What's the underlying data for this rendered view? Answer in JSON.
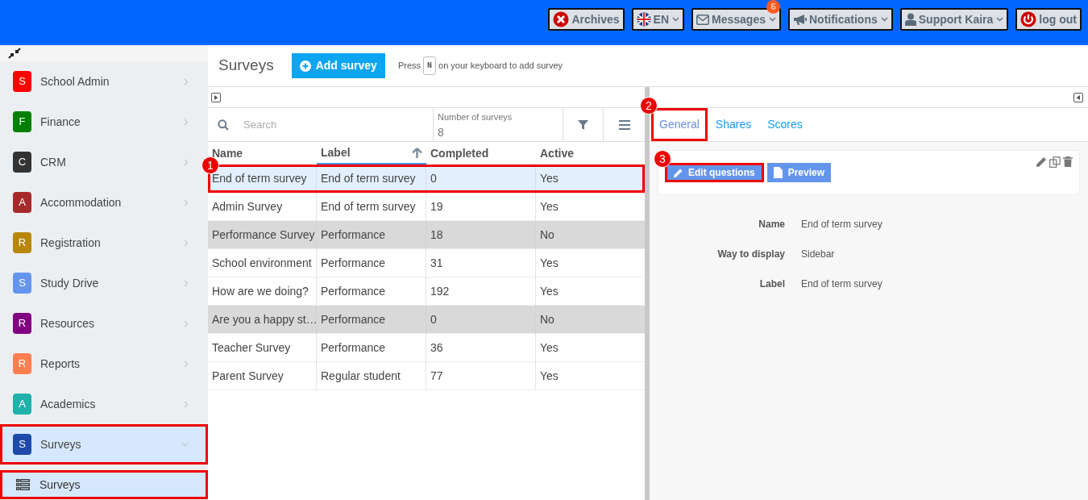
{
  "top_bar": {
    "buttons": [
      {
        "kind": "archives",
        "label": "Archives",
        "dropdown": false
      },
      {
        "kind": "language",
        "label": "EN",
        "dropdown": true
      },
      {
        "kind": "messages",
        "label": "Messages",
        "dropdown": true,
        "badge": "6"
      },
      {
        "kind": "notifications",
        "label": "Notifications",
        "dropdown": true
      },
      {
        "kind": "user",
        "label": "Support Kaira",
        "dropdown": true
      },
      {
        "kind": "logout",
        "label": "log out",
        "dropdown": false
      }
    ]
  },
  "sidebar": {
    "items": [
      {
        "letter": "S",
        "label": "School Admin",
        "color": "#ff0000",
        "selected": false,
        "expanded": false,
        "highlighted": false
      },
      {
        "letter": "F",
        "label": "Finance",
        "color": "#008000",
        "selected": false,
        "expanded": false,
        "highlighted": false
      },
      {
        "letter": "C",
        "label": "CRM",
        "color": "#333333",
        "selected": false,
        "expanded": false,
        "highlighted": false
      },
      {
        "letter": "A",
        "label": "Accommodation",
        "color": "#a52a2a",
        "selected": false,
        "expanded": false,
        "highlighted": false
      },
      {
        "letter": "R",
        "label": "Registration",
        "color": "#b8860b",
        "selected": false,
        "expanded": false,
        "highlighted": false
      },
      {
        "letter": "S",
        "label": "Study Drive",
        "color": "#6495ed",
        "selected": false,
        "expanded": false,
        "highlighted": false
      },
      {
        "letter": "R",
        "label": "Resources",
        "color": "#800080",
        "selected": false,
        "expanded": false,
        "highlighted": false
      },
      {
        "letter": "R",
        "label": "Reports",
        "color": "#ff7f50",
        "selected": false,
        "expanded": false,
        "highlighted": false
      },
      {
        "letter": "A",
        "label": "Academics",
        "color": "#20b2aa",
        "selected": false,
        "expanded": false,
        "highlighted": false
      },
      {
        "letter": "S",
        "label": "Surveys",
        "color": "#1e4bab",
        "selected": true,
        "expanded": true,
        "highlighted": true,
        "children": [
          {
            "label": "Surveys",
            "selected": true,
            "highlighted": true
          }
        ]
      }
    ]
  },
  "page_header": {
    "title": "Surveys",
    "add_button": "Add survey",
    "hint_before": "Press",
    "hint_key": "N",
    "hint_after": "on your keyboard to add survey"
  },
  "table": {
    "search": {
      "placeholder": "Search"
    },
    "count_label": "Number of surveys",
    "count": "8",
    "columns": [
      {
        "label": "Name",
        "sorted": false
      },
      {
        "label": "Label",
        "sorted": true
      },
      {
        "label": "Completed",
        "sorted": false
      },
      {
        "label": "Active",
        "sorted": false
      }
    ],
    "rows": [
      {
        "cells": [
          "End of term survey",
          "End of term survey",
          "0",
          "Yes"
        ],
        "selected": true,
        "greyed": false,
        "highlighted": true,
        "callout": "1"
      },
      {
        "cells": [
          "Admin Survey",
          "End of term survey",
          "19",
          "Yes"
        ],
        "selected": false,
        "greyed": false,
        "highlighted": false
      },
      {
        "cells": [
          "Performance Survey",
          "Performance",
          "18",
          "No"
        ],
        "selected": false,
        "greyed": true,
        "highlighted": false
      },
      {
        "cells": [
          "School environment",
          "Performance",
          "31",
          "Yes"
        ],
        "selected": false,
        "greyed": false,
        "highlighted": false
      },
      {
        "cells": [
          "How are we doing?",
          "Performance",
          "192",
          "Yes"
        ],
        "selected": false,
        "greyed": false,
        "highlighted": false
      },
      {
        "cells": [
          "Are you a happy st…",
          "Performance",
          "0",
          "No"
        ],
        "selected": false,
        "greyed": true,
        "highlighted": false
      },
      {
        "cells": [
          "Teacher Survey",
          "Performance",
          "36",
          "Yes"
        ],
        "selected": false,
        "greyed": false,
        "highlighted": false
      },
      {
        "cells": [
          "Parent Survey",
          "Regular student",
          "77",
          "Yes"
        ],
        "selected": false,
        "greyed": false,
        "highlighted": false
      }
    ]
  },
  "detail": {
    "tabs": [
      {
        "label": "General",
        "selected": true,
        "highlighted": true,
        "callout": "2"
      },
      {
        "label": "Shares",
        "selected": false,
        "highlighted": false
      },
      {
        "label": "Scores",
        "selected": false,
        "highlighted": false
      }
    ],
    "buttons": [
      {
        "kind": "edit",
        "label": "Edit questions",
        "highlighted": true,
        "callout": "3"
      },
      {
        "kind": "preview",
        "label": "Preview",
        "highlighted": false
      }
    ],
    "fields": [
      {
        "label": "Name",
        "value": "End of term survey"
      },
      {
        "label": "Way to display",
        "value": "Sidebar"
      },
      {
        "label": "Label",
        "value": "End of term survey"
      }
    ]
  }
}
